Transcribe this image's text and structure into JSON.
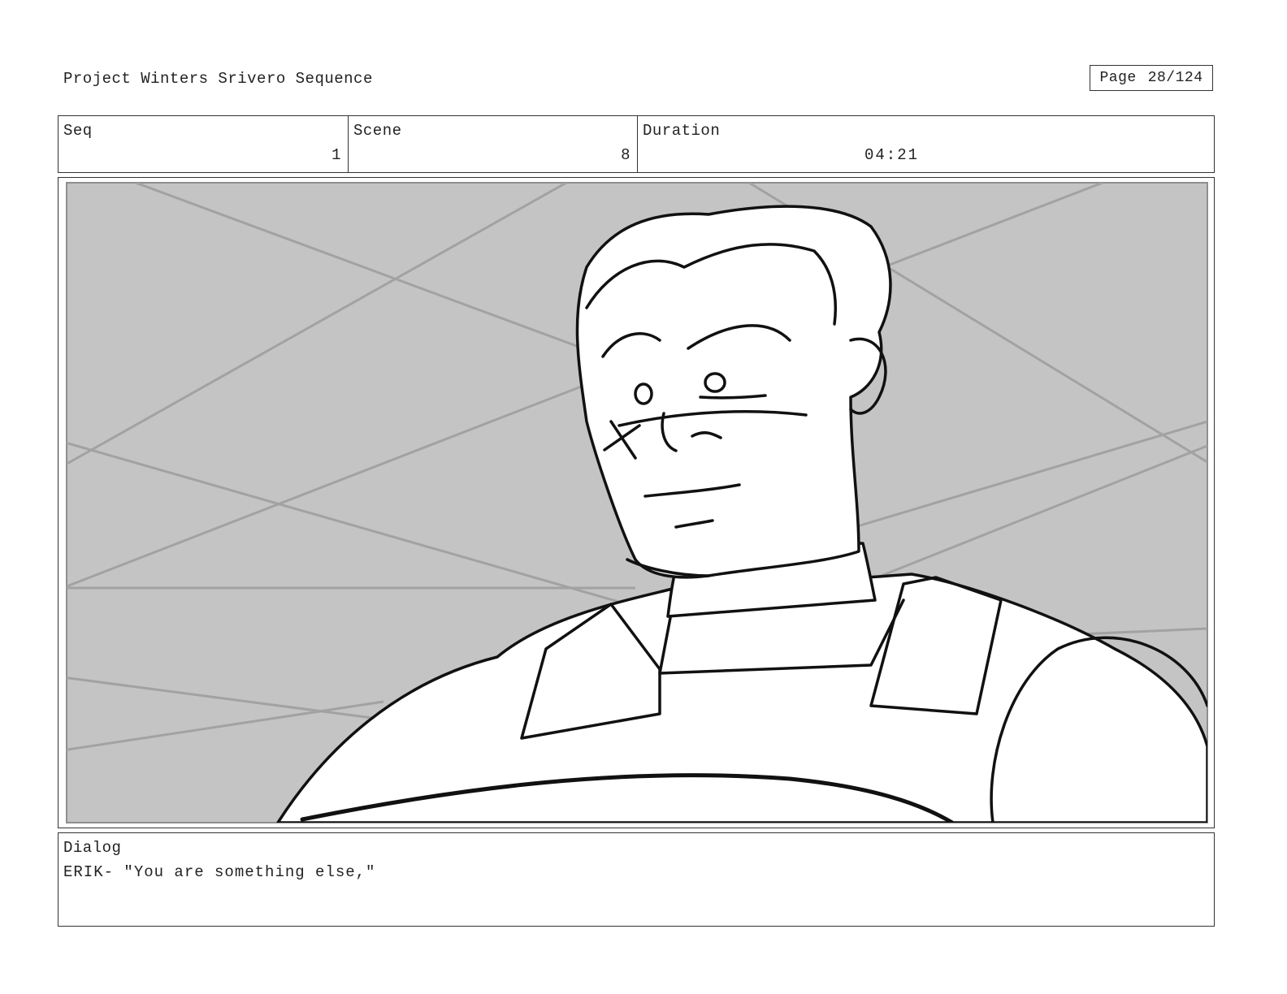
{
  "header": {
    "project_title": "Project Winters Srivero Sequence",
    "page_label": "Page",
    "page_number": "28/124"
  },
  "info": {
    "seq_label": "Seq",
    "seq_value": "1",
    "scene_label": "Scene",
    "scene_value": "8",
    "duration_label": "Duration",
    "duration_value": "04:21"
  },
  "panel": {
    "background_color": "#c4c4c4",
    "line_color": "#a2a2a2",
    "ink_color": "#111111"
  },
  "dialog": {
    "label": "Dialog",
    "text": "ERIK- \"You are something else,\""
  }
}
